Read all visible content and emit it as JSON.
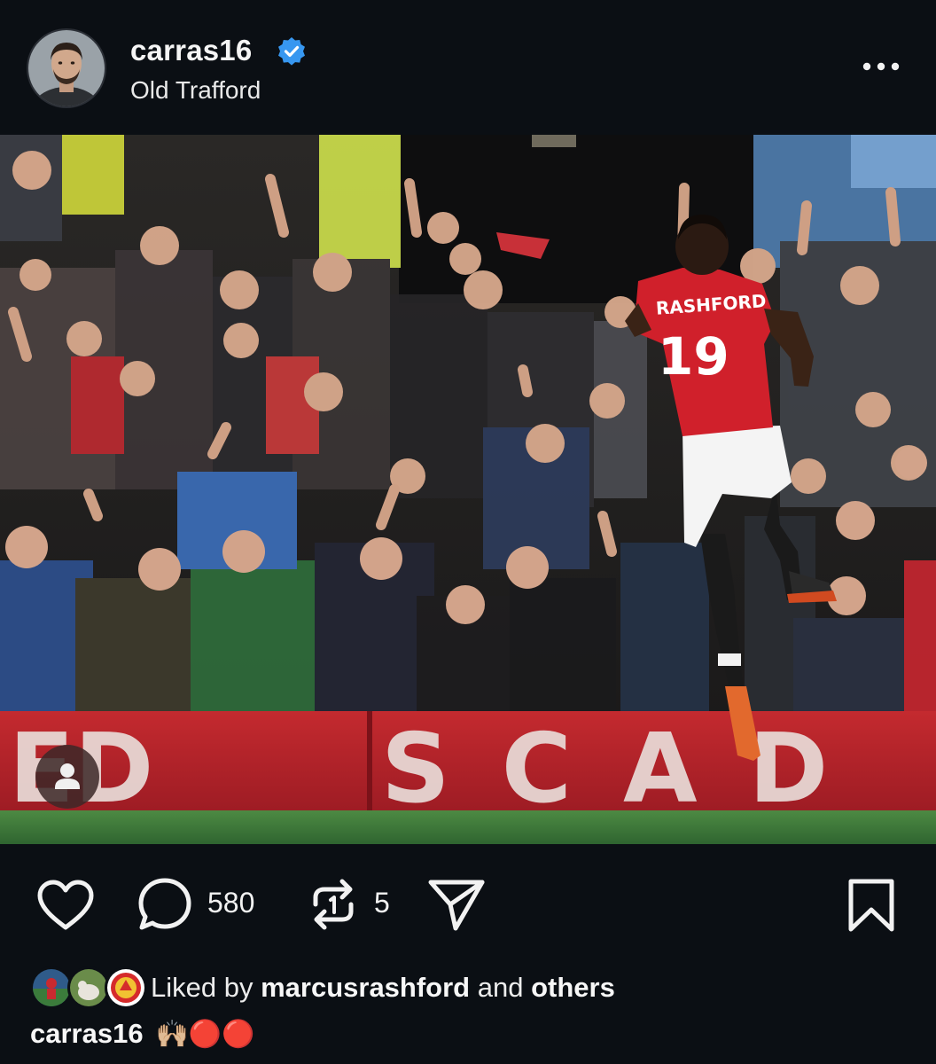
{
  "post": {
    "username": "carras16",
    "location": "Old Trafford",
    "verified": true,
    "comment_count": "580",
    "repost_count": "5",
    "liked_by_prefix": "Liked by",
    "liked_by_user": "marcusrashford",
    "liked_by_and": "and",
    "liked_by_others": "others",
    "caption_user": "carras16",
    "caption_text": "🙌🏼🔴🔴"
  },
  "photo": {
    "player_name": "RASHFORD",
    "player_number": "19",
    "board_text": "ED  SCAD"
  },
  "icons": {
    "verified": "verified-badge-icon",
    "more": "more-horizontal-icon",
    "like": "heart-icon",
    "comment": "comment-bubble-icon",
    "repost": "repost-icon",
    "share": "send-icon",
    "save": "bookmark-icon",
    "tag": "user-tag-icon"
  },
  "colors": {
    "background": "#0b0f14",
    "verified_blue": "#3797f0",
    "kit_red": "#d0202b",
    "board_red": "#b2202a",
    "pitch_green": "#3f7a3a"
  }
}
